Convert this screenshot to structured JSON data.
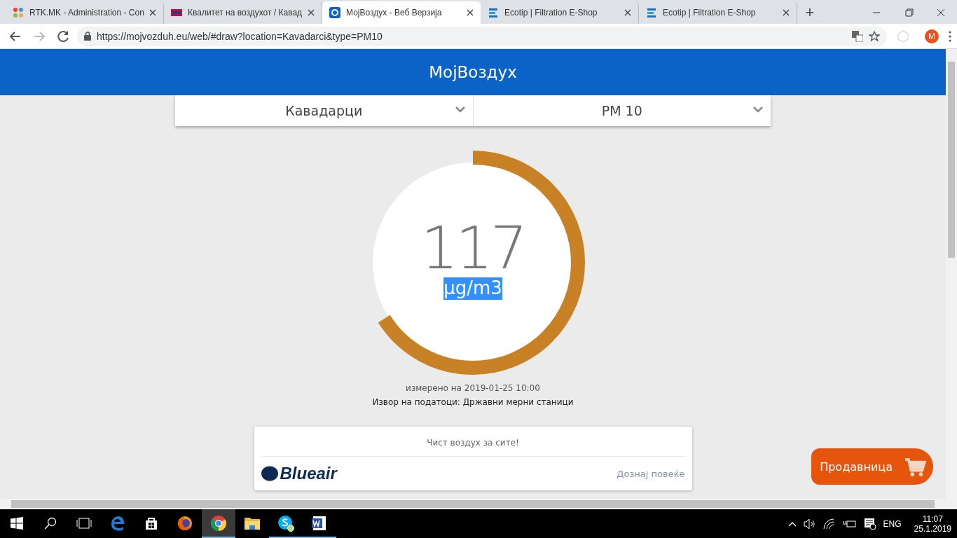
{
  "browser": {
    "tabs": [
      {
        "title": "RTK.MK - Administration - Con",
        "kind": "joomla",
        "selected": false
      },
      {
        "title": "Квалитет на воздухот / Кавад",
        "kind": "rtk",
        "selected": false
      },
      {
        "title": "МојВоздух - Веб Верзија",
        "kind": "mojvozduh",
        "selected": true
      },
      {
        "title": "Ecotip | Filtration E-Shop",
        "kind": "ecotip",
        "selected": false
      },
      {
        "title": "Ecotip | Filtration E-Shop",
        "kind": "ecotip",
        "selected": false
      }
    ],
    "new_tab": "+",
    "address": "https://mojvozduh.eu/web/#draw?location=Kavadarci&type=PM10",
    "profile_initial": "M"
  },
  "page": {
    "title": "МојВоздух",
    "location": "Кавадарци",
    "pollutant": "PM 10",
    "value": "117",
    "unit": "µg/m3",
    "unit_highlighted": true,
    "level": 0.66,
    "measured": "измерено на 2019-01-25 10:00",
    "source": "Извор на податоци: Државни мерни станици",
    "ad": {
      "headline": "Чист воздух за сите!",
      "brand": "Blueair",
      "link": "Дознај повеќе"
    },
    "shop_button": "Продавница"
  },
  "taskbar": {
    "apps": [
      {
        "kind": "edge",
        "active": false,
        "running": false
      },
      {
        "kind": "store",
        "active": false,
        "running": false
      },
      {
        "kind": "firefox",
        "active": false,
        "running": false
      },
      {
        "kind": "chrome",
        "active": true,
        "running": true
      },
      {
        "kind": "folder",
        "active": false,
        "running": false
      },
      {
        "kind": "skype",
        "active": false,
        "running": true
      },
      {
        "kind": "word",
        "active": false,
        "running": true
      }
    ],
    "language": "ENG",
    "time": "11:07",
    "date": "25.1.2019"
  }
}
